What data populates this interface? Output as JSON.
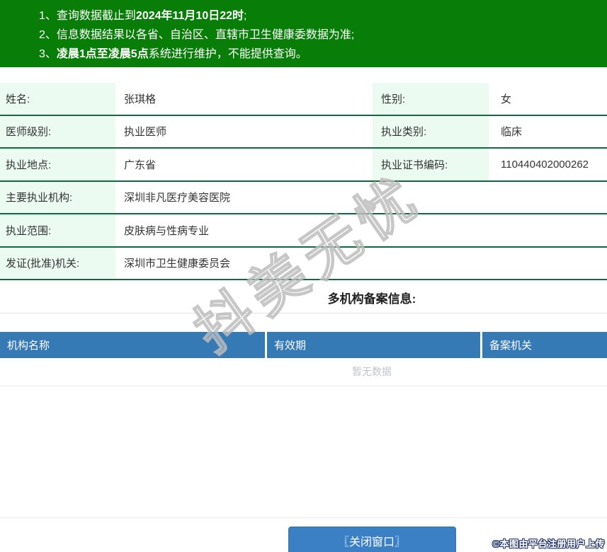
{
  "notice": {
    "lines": [
      {
        "num": "1、",
        "pre": "查询数据截止到",
        "bold": "2024年11月10日22时",
        "post": ";"
      },
      {
        "num": "2、",
        "pre": "信息数据结果以各省、自治区、直辖市卫生健康委数据为准;",
        "bold": "",
        "post": ""
      },
      {
        "num": "3、",
        "pre": "",
        "bold": "凌晨1点至凌晨5点",
        "post": "系统进行维护，不能提供查询。"
      }
    ]
  },
  "profile": {
    "rows2col": [
      {
        "label1": "姓名:",
        "value1": "张琪格",
        "label2": "性别:",
        "value2": "女"
      },
      {
        "label1": "医师级别:",
        "value1": "执业医师",
        "label2": "执业类别:",
        "value2": "临床"
      },
      {
        "label1": "执业地点:",
        "value1": "广东省",
        "label2": "执业证书编码:",
        "value2": "110440402000262"
      }
    ],
    "rows1col": [
      {
        "label": "主要执业机构:",
        "value": "深圳非凡医疗美容医院"
      },
      {
        "label": "执业范围:",
        "value": "皮肤病与性病专业"
      },
      {
        "label": "发证(批准)机关:",
        "value": "深圳市卫生健康委员会"
      }
    ]
  },
  "records": {
    "title": "多机构备案信息:",
    "columns": [
      "机构名称",
      "有效期",
      "备案机关"
    ],
    "empty_text": "暂无数据"
  },
  "watermark": {
    "text": "抖美无忧"
  },
  "footer": {
    "close_button": "〖关闭窗口〗",
    "copyright": "©本图由平台注册用户上传"
  },
  "colors": {
    "banner_green": "#087e08",
    "row_line_green": "#0e6b40",
    "label_bg_mint": "#ebfbf2",
    "header_blue": "#3579b5",
    "button_blue": "#3b80c4",
    "empty_text_gray": "#c0c4cc",
    "copyright_outline_navy": "#26386e"
  }
}
